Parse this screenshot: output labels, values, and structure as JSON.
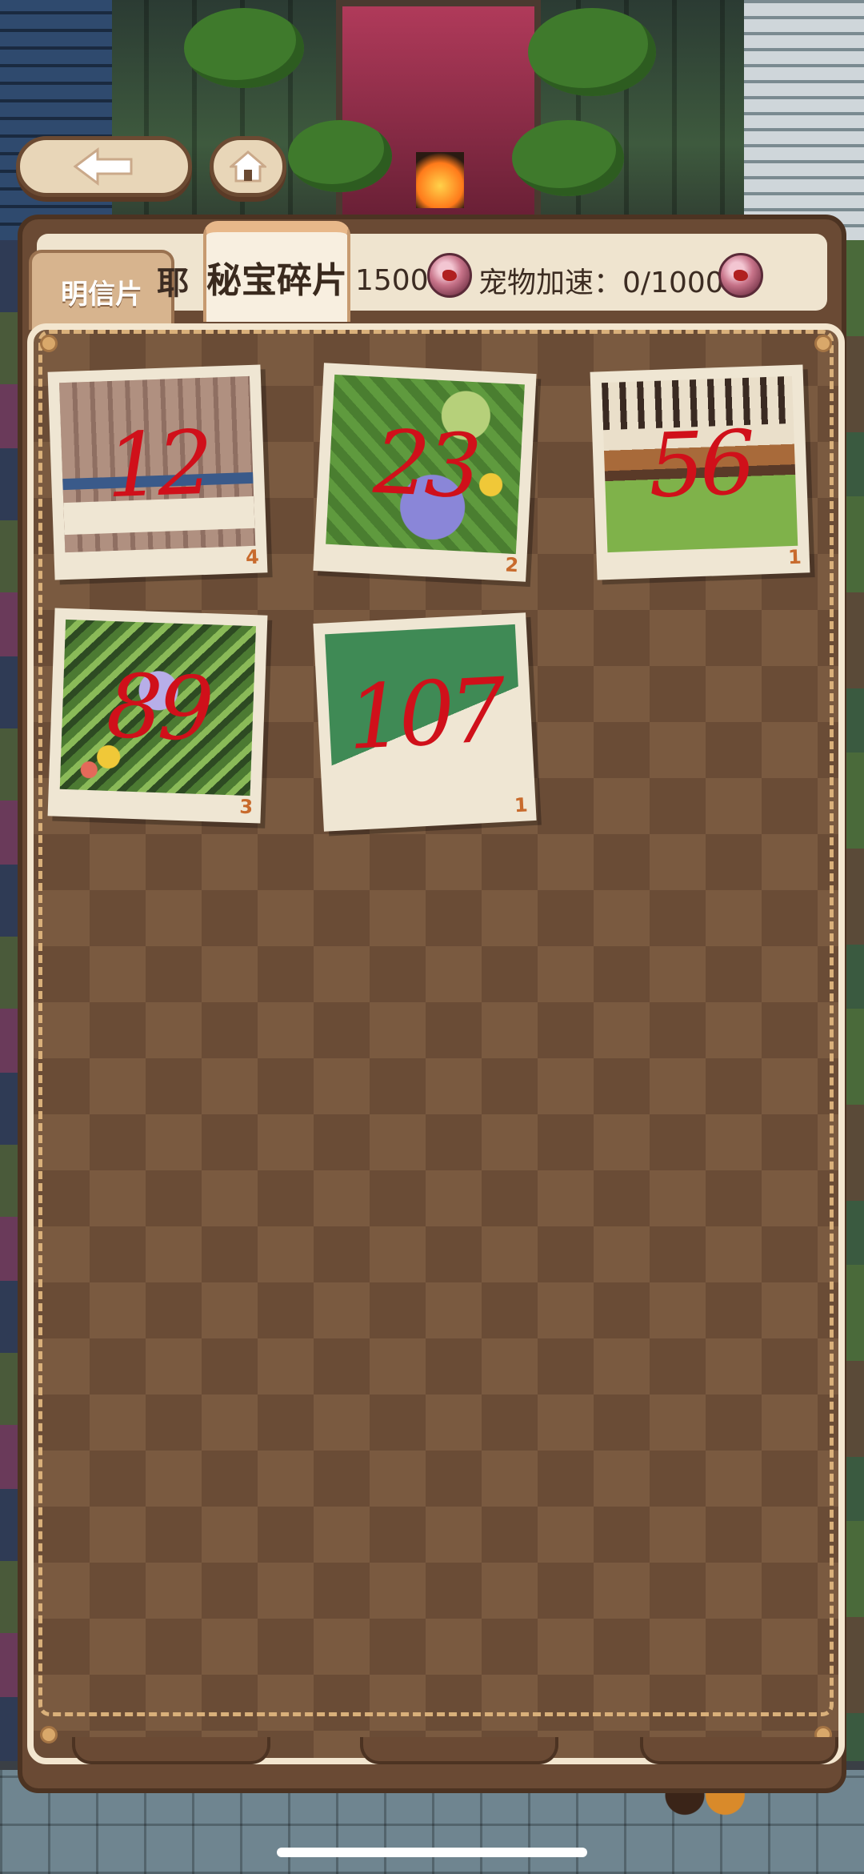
{
  "header": {
    "tab_postcard": "明信片",
    "tab_fragments": "秘宝碎片",
    "partial_text": "耶",
    "collect_value": "1500",
    "pet_label": "宠物加速：0/1000"
  },
  "fragments": [
    {
      "id": "12",
      "count": "4"
    },
    {
      "id": "23",
      "count": "2"
    },
    {
      "id": "56",
      "count": "1"
    },
    {
      "id": "89",
      "count": "3"
    },
    {
      "id": "107",
      "count": "1"
    }
  ],
  "colors": {
    "panel_brown": "#6a4a34",
    "count_orange": "#c86a2c",
    "annotation_red": "#d0101a",
    "card_paper": "#efe6d3"
  },
  "icons": {
    "back": "arrow-left-icon",
    "home": "home-icon",
    "currency": "gem-icon"
  }
}
